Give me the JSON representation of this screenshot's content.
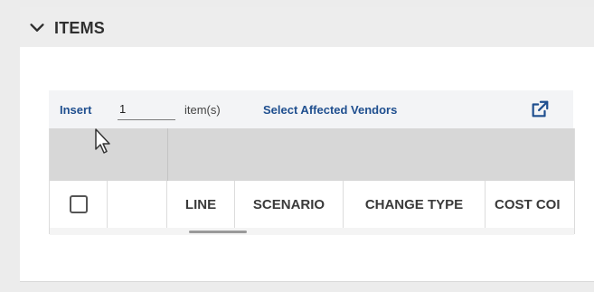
{
  "section": {
    "title": "ITEMS",
    "chevron_icon": "chevron-down-icon"
  },
  "toolbar": {
    "insert_label": "Insert",
    "quantity_value": "1",
    "items_suffix": "item(s)",
    "select_vendors_label": "Select Affected Vendors",
    "open_icon": "open-in-new-icon"
  },
  "grid": {
    "columns": [
      "",
      "",
      "LINE",
      "SCENARIO",
      "CHANGE TYPE",
      "COST COI"
    ]
  },
  "colors": {
    "link": "#1f4f8f",
    "grid_band": "#d7d7d7",
    "toolbar_bg": "#f3f4f6"
  }
}
